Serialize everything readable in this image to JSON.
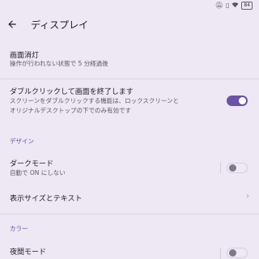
{
  "status_bar": {
    "icons": [
      "mute-icon",
      "vibrate-icon",
      "wifi-icon"
    ],
    "battery": "84"
  },
  "header": {
    "title": "ディスプレイ"
  },
  "items": {
    "screen_off": {
      "title": "画面消灯",
      "subtitle": "操作が行われない状態で 5 分経過後"
    },
    "double_tap": {
      "title": "ダブルクリックして画面を終了します",
      "subtitle_line1": "スクリーンをダブルクリックする機能は、ロックスクリーンと",
      "subtitle_line2": "オリジナルデスクトップの下でのみ有効です",
      "enabled": true
    },
    "dark_mode": {
      "title": "ダークモード",
      "subtitle": "自動で ON にしない",
      "enabled": false
    },
    "display_size": {
      "title": "表示サイズとテキスト"
    },
    "night_mode": {
      "title": "夜間モード",
      "enabled": false
    }
  },
  "sections": {
    "design": "デザイン",
    "color": "カラー"
  },
  "colors": {
    "accent": "#6b53a3",
    "background": "#eee7f4",
    "section_text": "#6b4ea2"
  }
}
